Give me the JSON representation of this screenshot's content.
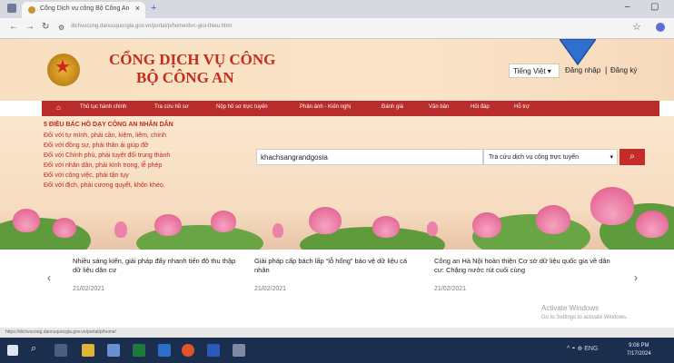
{
  "browser": {
    "tab_title": "Cổng Dịch vụ công Bộ Công An",
    "tab_close": "×",
    "new_tab": "+",
    "url": "dichvucong.dancuquocgia.gov.vn/portal/p/home/dvc-gioi-thieu.html",
    "window_minimize": "–",
    "window_maximize": "▢"
  },
  "header": {
    "title_line1": "CỔNG DỊCH VỤ CÔNG",
    "title_line2": "BỘ CÔNG AN",
    "language": "Tiếng Việt ▾",
    "login": "Đăng nhập",
    "separator": "|",
    "register": "Đăng ký"
  },
  "menu": {
    "home_icon": "home-icon",
    "items": [
      "Thủ tục hành chính",
      "Tra cứu hồ sơ",
      "Nộp hồ sơ trực tuyến",
      "Phản ánh - Kiến nghị",
      "Đánh giá",
      "Văn bản",
      "Hỏi đáp",
      "Hỗ trợ"
    ]
  },
  "teachings": {
    "title": "5 ĐIỀU BÁC HỒ DẠY CÔNG AN NHÂN DÂN",
    "lines": [
      "Đối với tự mình, phải cần, kiệm, liêm, chính",
      "Đối với đồng sự, phải thân ái giúp đỡ",
      "Đối với Chính phủ, phải tuyệt đối trung thành",
      "Đối với nhân dân, phải kính trọng, lễ phép",
      "Đối với công việc, phải tận tụy",
      "Đối với địch, phải cương quyết, khôn khéo."
    ]
  },
  "search": {
    "value": "khachsangrandgosia",
    "select_value": "Tra cứu dịch vụ công trực tuyến",
    "select_caret": "▾",
    "button_icon": "search-icon"
  },
  "news": {
    "prev": "‹",
    "next": "›",
    "items": [
      {
        "title": "Nhiều sáng kiến, giải pháp đẩy nhanh tiến độ thu thập dữ liệu dân cư",
        "date": "21/02/2021"
      },
      {
        "title": "Giải pháp cấp bách lấp “lỗ hổng” bảo vệ dữ liệu cá nhân",
        "date": "21/02/2021"
      },
      {
        "title": "Công an Hà Nội hoàn thiện Cơ sở dữ liệu quốc gia về dân cư: Chặng nước rút cuối cùng",
        "date": "21/02/2021"
      }
    ]
  },
  "watermark": {
    "line1": "Activate Windows",
    "line2": "Go to Settings to activate Windows."
  },
  "statusbar": {
    "url": "https://dichvucong.dancuquocgia.gov.vn/portal/p/home/"
  },
  "taskbar": {
    "tray": "^ ◓ ⊕ ENG",
    "time": "9:08 PM",
    "date": "7/17/2024"
  },
  "colors": {
    "accent_red": "#b82c2c",
    "title_red": "#c42c1c",
    "header_bg": "#fbe4c9",
    "arrow_blue": "#2e6fd0"
  }
}
